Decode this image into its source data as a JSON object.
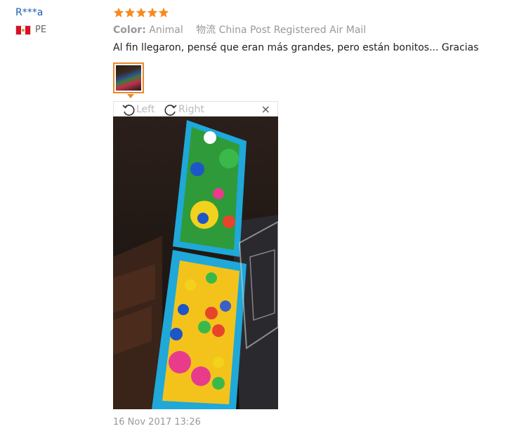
{
  "reviewer": {
    "name": "R***a",
    "country_code": "PE",
    "flag": "peru-flag-icon"
  },
  "rating": {
    "stars": 5,
    "max": 5,
    "color": "#f58a1f"
  },
  "order_info": {
    "color_label": "Color:",
    "color_value": "Animal",
    "shipping": "物流 China Post Registered Air Mail"
  },
  "review_text": "Al fin llegaron, pensé que eran más grandes, pero están bonitos... Gracias",
  "viewer": {
    "rotate_left_label": "Left",
    "rotate_right_label": "Right",
    "close_label": "×",
    "thumbnail_count": 1
  },
  "date": "16 Nov 2017 13:26",
  "colors": {
    "accent": "#e8892b",
    "username": "#1e5fa8",
    "muted": "#999999"
  }
}
